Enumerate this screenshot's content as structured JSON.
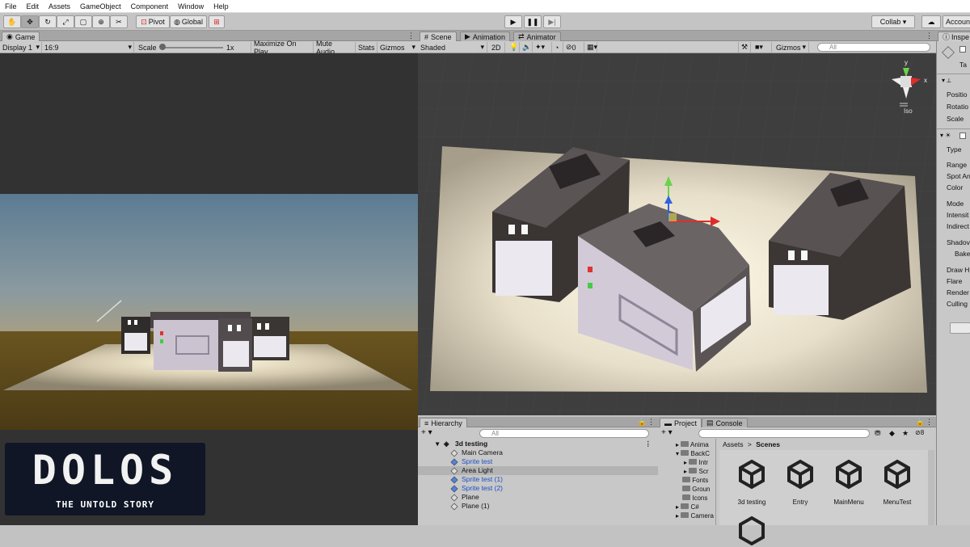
{
  "menu": [
    "File",
    "Edit",
    "Assets",
    "GameObject",
    "Component",
    "Window",
    "Help"
  ],
  "toolbar": {
    "pivot": "Pivot",
    "global": "Global",
    "collab": "Collab ▾",
    "account": "Accoun"
  },
  "game": {
    "tab": "Game",
    "display": "Display 1",
    "aspect": "16:9",
    "scale_label": "Scale",
    "scale_value": "1x",
    "maximize": "Maximize On Play",
    "mute": "Mute Audio",
    "stats": "Stats",
    "gizmos": "Gizmos"
  },
  "scene": {
    "tabs": [
      "Scene",
      "Animation",
      "Animator"
    ],
    "shading": "Shaded",
    "mode2d": "2D",
    "hidden_count": "0",
    "gizmos": "Gizmos",
    "search_placeholder": "All",
    "persp": "Iso",
    "axis_y": "y",
    "axis_x": "x"
  },
  "hierarchy": {
    "tab": "Hierarchy",
    "search_placeholder": "All",
    "scene_name": "3d testing",
    "items": [
      {
        "name": "Main Camera",
        "prefab": false
      },
      {
        "name": "Sprite test",
        "prefab": true
      },
      {
        "name": "Area Light",
        "prefab": false
      },
      {
        "name": "Sprite test (1)",
        "prefab": true
      },
      {
        "name": "Sprite test (2)",
        "prefab": true
      },
      {
        "name": "Plane",
        "prefab": false
      },
      {
        "name": "Plane (1)",
        "prefab": false
      }
    ]
  },
  "project": {
    "tabs": [
      "Project",
      "Console"
    ],
    "hidden_count": "8",
    "breadcrumb_root": "Assets",
    "breadcrumb_leaf": "Scenes",
    "tree": [
      "Anima",
      "BackC",
      "Intr",
      "Scr",
      "Fonts",
      "Groun",
      "Icons",
      "C#",
      "Camera"
    ],
    "assets": [
      "3d testing",
      "Entry",
      "MainMenu",
      "MenuTest"
    ]
  },
  "inspector": {
    "tab": "Inspe",
    "tag": "Ta",
    "transform_rows": [
      "Positio",
      "Rotatio",
      "Scale"
    ],
    "light_rows": [
      "Type",
      "Range",
      "Spot An",
      "Color",
      "Mode",
      "Intensit",
      "Indirect",
      "Shadov",
      "Bake",
      "Draw H",
      "Flare",
      "Render",
      "Culling"
    ]
  },
  "logo": {
    "title": "DOLOS",
    "subtitle": "THE UNTOLD STORY"
  }
}
